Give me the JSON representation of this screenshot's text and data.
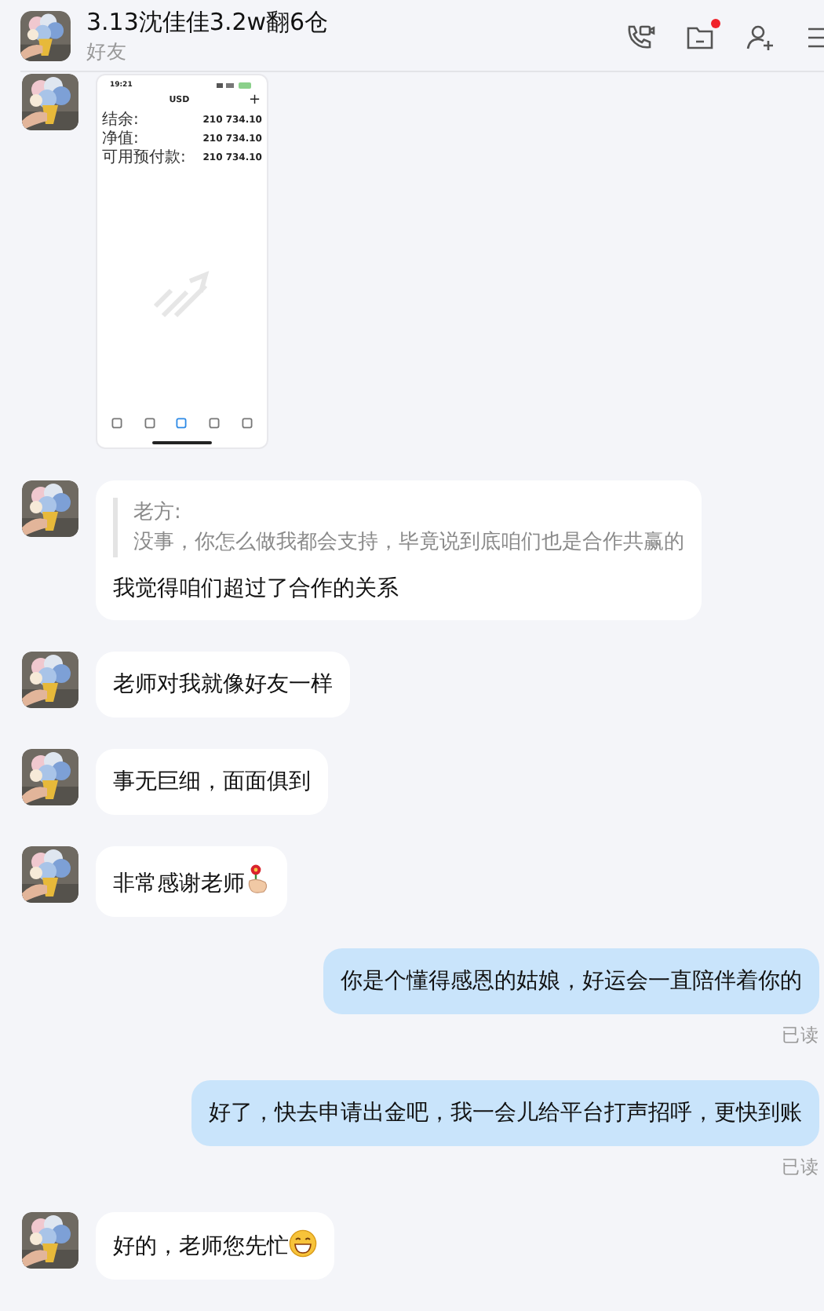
{
  "header": {
    "title": "3.13沈佳佳3.2w翻6仓",
    "subtitle": "好友",
    "notification_dot": true
  },
  "messages": [
    {
      "outgoing": false,
      "screenshot": {
        "time": "19:21",
        "currency": "USD",
        "add": "+",
        "rows": [
          {
            "label": "结余:",
            "value": "210 734.10"
          },
          {
            "label": "净值:",
            "value": "210 734.10"
          },
          {
            "label": "可用预付款:",
            "value": "210 734.10"
          }
        ],
        "tabs": [
          {
            "selected": false
          },
          {
            "selected": false
          },
          {
            "selected": true
          },
          {
            "selected": false
          },
          {
            "selected": false
          }
        ]
      }
    },
    {
      "kind": "quote",
      "outgoing": false,
      "quote_author": "老方:",
      "quote_text": "没事，你怎么做我都会支持，毕竟说到底咱们也是合作共赢的",
      "text": "我觉得咱们超过了合作的关系"
    },
    {
      "kind": "text",
      "outgoing": false,
      "text": "老师对我就像好友一样"
    },
    {
      "kind": "text",
      "outgoing": false,
      "text": "事无巨细，面面俱到"
    },
    {
      "kind": "text",
      "outgoing": false,
      "text": "非常感谢老师",
      "sticker": {
        "kind": "flower"
      }
    },
    {
      "kind": "text",
      "outgoing": true,
      "text": "你是个懂得感恩的姑娘，好运会一直陪伴着你的",
      "status": "已读"
    },
    {
      "kind": "text",
      "outgoing": true,
      "text": "好了，快去申请出金吧，我一会儿给平台打声招呼，更快到账",
      "status": "已读"
    },
    {
      "kind": "text",
      "outgoing": false,
      "text": "好的，老师您先忙",
      "sticker": {
        "kind": "grin"
      }
    }
  ]
}
